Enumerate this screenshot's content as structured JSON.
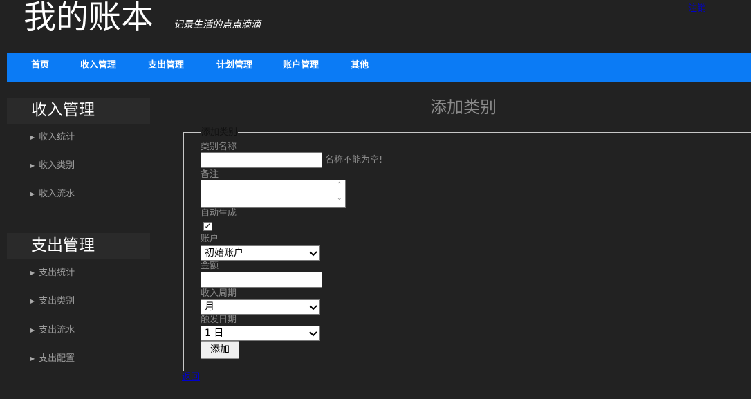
{
  "header": {
    "title": "我的账本",
    "tagline": "记录生活的点点滴滴",
    "logout": "注销"
  },
  "nav": {
    "items": [
      "首页",
      "收入管理",
      "支出管理",
      "计划管理",
      "账户管理",
      "其他"
    ]
  },
  "sidebar": {
    "sections": [
      {
        "heading": "收入管理",
        "items": [
          "收入统计",
          "收入类别",
          "收入流水"
        ]
      },
      {
        "heading": "支出管理",
        "items": [
          "支出统计",
          "支出类别",
          "支出流水",
          "支出配置"
        ]
      }
    ]
  },
  "main": {
    "title": "添加类别",
    "form": {
      "legend": "添加类别",
      "name_label": "类别名称",
      "name_value": "",
      "name_error": "名称不能为空!",
      "note_label": "备注",
      "auto_label": "自动生成",
      "auto_checked": true,
      "account_label": "账户",
      "account_value": "初始账户",
      "amount_label": "金额",
      "amount_value": "",
      "period_label": "收入周期",
      "period_value": "月",
      "trigger_label": "触发日期",
      "trigger_value": "1 日",
      "submit_label": "添加"
    },
    "back_link": "返回"
  }
}
